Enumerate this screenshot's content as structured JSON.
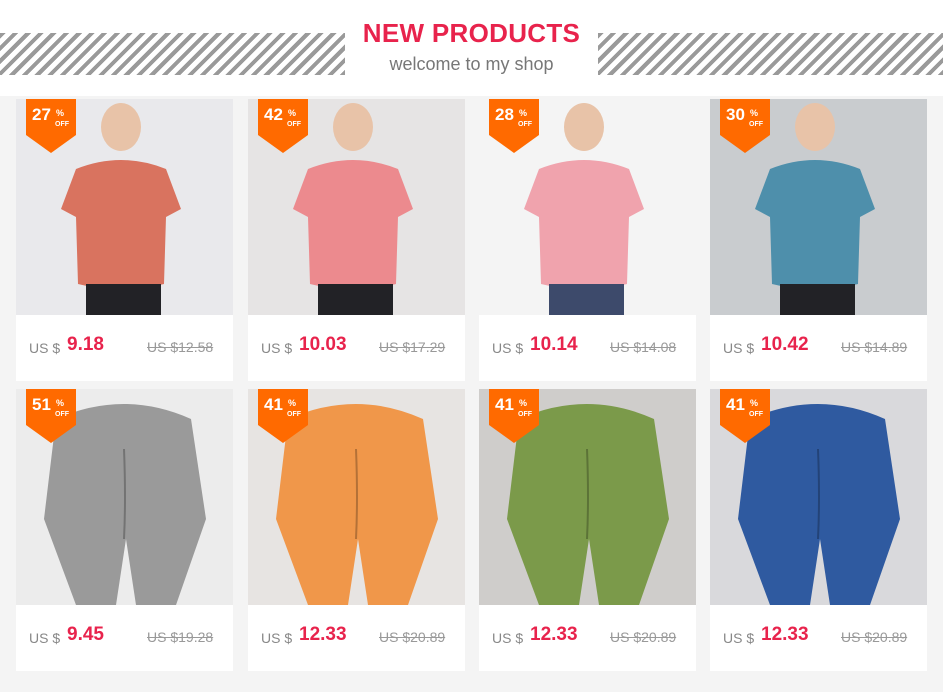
{
  "header": {
    "title": "NEW PRODUCTS",
    "subtitle": "welcome to my shop"
  },
  "colors": {
    "accent": "#e8234c",
    "badge": "#ff6a00"
  },
  "products": [
    {
      "discount": "27",
      "currency": "US $",
      "price": "9.18",
      "old_price": "US $12.58",
      "item": "coral short-sleeve top",
      "color": "#d9735f",
      "bg": "#e9e9ec"
    },
    {
      "discount": "42",
      "currency": "US $",
      "price": "10.03",
      "old_price": "US $17.29",
      "item": "pink seamless top",
      "color": "#ec8a8e",
      "bg": "#e6e4e4"
    },
    {
      "discount": "28",
      "currency": "US $",
      "price": "10.14",
      "old_price": "US $14.08",
      "item": "pink top and navy shorts",
      "color": "#f0a3ad",
      "bg": "#f4f4f4"
    },
    {
      "discount": "30",
      "currency": "US $",
      "price": "10.42",
      "old_price": "US $14.89",
      "item": "teal blue top",
      "color": "#4e8fab",
      "bg": "#c9cccf"
    },
    {
      "discount": "51",
      "currency": "US $",
      "price": "9.45",
      "old_price": "US $19.28",
      "item": "grey textured leggings",
      "color": "#9a9a9a",
      "bg": "#ececec"
    },
    {
      "discount": "41",
      "currency": "US $",
      "price": "12.33",
      "old_price": "US $20.89",
      "item": "orange ribbed leggings",
      "color": "#f0974a",
      "bg": "#e7e4e2"
    },
    {
      "discount": "41",
      "currency": "US $",
      "price": "12.33",
      "old_price": "US $20.89",
      "item": "green textured leggings",
      "color": "#7b9a4a",
      "bg": "#cfcdcb"
    },
    {
      "discount": "41",
      "currency": "US $",
      "price": "12.33",
      "old_price": "US $20.89",
      "item": "blue seamless leggings",
      "color": "#2f5aa0",
      "bg": "#d9d9dc"
    }
  ],
  "badge_labels": {
    "percent": "%",
    "off": "OFF"
  }
}
